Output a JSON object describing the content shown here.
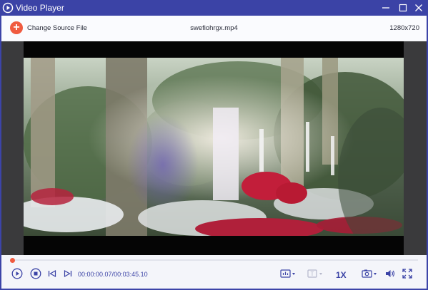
{
  "window": {
    "title": "Video Player"
  },
  "header": {
    "change_source_label": "Change Source File",
    "filename": "swefiohrgx.mp4",
    "resolution": "1280x720"
  },
  "playback": {
    "current_time": "00:00:00.07",
    "separator": "/",
    "total_time": "00:03:45.10",
    "progress_fraction": 0.0003,
    "speed": "1X"
  },
  "icons": {
    "app": "play-circle-icon",
    "minimize": "minimize-icon",
    "maximize": "maximize-icon",
    "close": "close-icon",
    "add": "plus-icon",
    "play": "play-icon",
    "stop": "stop-icon",
    "prev": "previous-frame-icon",
    "next": "next-frame-icon",
    "audio_track": "audio-track-icon",
    "subtitle": "subtitle-icon",
    "snapshot": "camera-icon",
    "volume": "volume-icon",
    "fullscreen": "fullscreen-icon"
  },
  "colors": {
    "accent": "#3b43a6",
    "add_button": "#f05b3f",
    "titlebar": "#3b43a6"
  }
}
